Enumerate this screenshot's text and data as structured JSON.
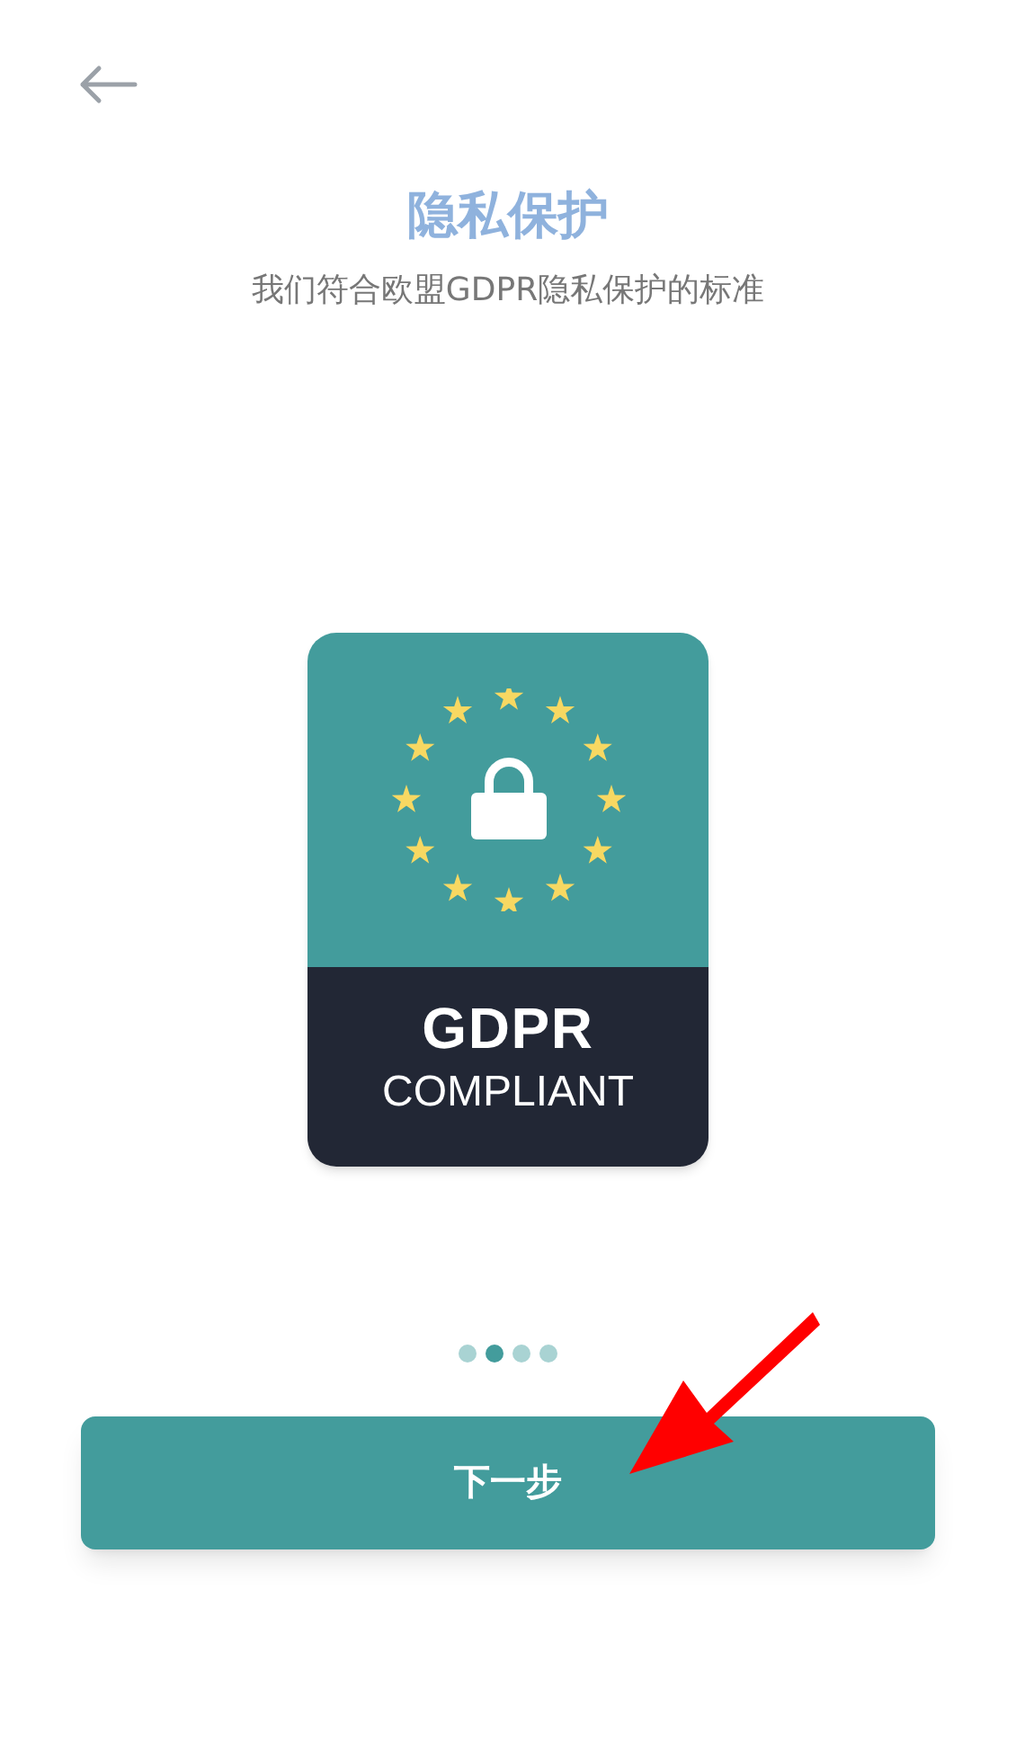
{
  "title": "隐私保护",
  "subtitle": "我们符合欧盟GDPR隐私保护的标准",
  "badge": {
    "heading": "GDPR",
    "caption": "COMPLIANT"
  },
  "pager": [
    {
      "selected": false
    },
    {
      "selected": true
    },
    {
      "selected": false
    },
    {
      "selected": false
    }
  ],
  "next_button": {
    "label": "下一步"
  }
}
